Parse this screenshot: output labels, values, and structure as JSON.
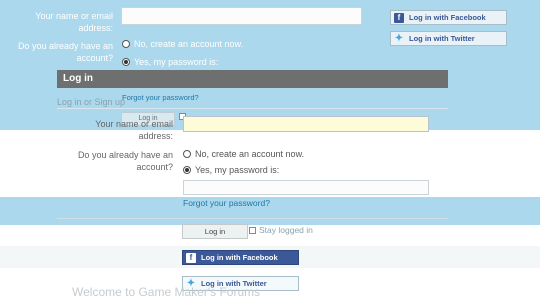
{
  "page": {
    "welcome": "Welcome to Game Maker's Forums",
    "breadcrumb": "Log in or Sign up"
  },
  "back_form": {
    "name_label": "Your name or email address:",
    "account_label": "Do you already have an account?",
    "opt_new": "No, create an account now.",
    "opt_yes": "Yes, my password is:",
    "forgot": "Forgot your password?",
    "login_button": "Log in",
    "social": {
      "facebook": "Log in with Facebook",
      "twitter": "Log in with Twitter"
    }
  },
  "dialog": {
    "title": "Log in",
    "name_label": "Your name or email address:",
    "name_value": "",
    "account_label": "Do you already have an account?",
    "opt_new": "No, create an account now.",
    "opt_yes": "Yes, my password is:",
    "password_value": "",
    "forgot": "Forgot your password?",
    "login_button": "Log in",
    "stay_logged": "Stay logged in",
    "social": {
      "facebook": "Log in with Facebook",
      "twitter": "Log in with Twitter"
    }
  },
  "colors": {
    "overlay_blue": "#abd8ec",
    "dialog_header": "#6e6f6f",
    "facebook": "#3b5998",
    "twitter": "#4aa3dc",
    "link": "#2377a6",
    "field_focus": "#fdfbd8"
  },
  "icons": {
    "facebook": "facebook-icon",
    "twitter": "twitter-icon"
  }
}
